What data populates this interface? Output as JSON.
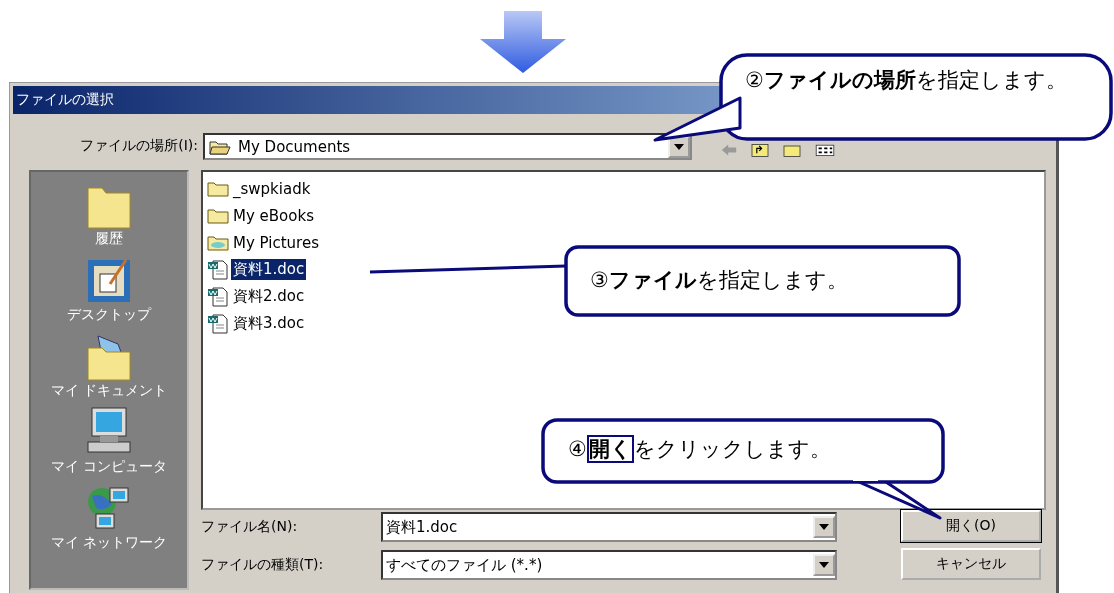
{
  "window": {
    "title": "ファイルの選択"
  },
  "location": {
    "label": "ファイルの場所(I):",
    "value": "My Documents"
  },
  "places": [
    {
      "label": "履歴",
      "kind": "history"
    },
    {
      "label": "デスクトップ",
      "kind": "desktop"
    },
    {
      "label": "マイ ドキュメント",
      "kind": "documents"
    },
    {
      "label": "マイ コンピュータ",
      "kind": "computer"
    },
    {
      "label": "マイ ネットワーク",
      "kind": "network"
    }
  ],
  "files": [
    {
      "name": "_swpkiadk",
      "kind": "folder",
      "selected": false
    },
    {
      "name": "My eBooks",
      "kind": "folder",
      "selected": false
    },
    {
      "name": "My Pictures",
      "kind": "pictures",
      "selected": false
    },
    {
      "name": "資料1.doc",
      "kind": "doc",
      "selected": true
    },
    {
      "name": "資料2.doc",
      "kind": "doc",
      "selected": false
    },
    {
      "name": "資料3.doc",
      "kind": "doc",
      "selected": false
    }
  ],
  "filename": {
    "label": "ファイル名(N):",
    "value": "資料1.doc"
  },
  "filetype": {
    "label": "ファイルの種類(T):",
    "value": "すべてのファイル (*.*)"
  },
  "buttons": [
    {
      "label": "開く(O)",
      "kind": "default"
    },
    {
      "label": "キャンセル",
      "kind": "normal"
    }
  ],
  "callouts": [
    {
      "text": "②**ファイルの場所**を指定します。",
      "boxed_emphasis": false
    },
    {
      "text": "③**ファイル**を指定します。",
      "boxed_emphasis": false
    },
    {
      "text": "④**開く**をクリックします。",
      "boxed_emphasis": true
    }
  ]
}
